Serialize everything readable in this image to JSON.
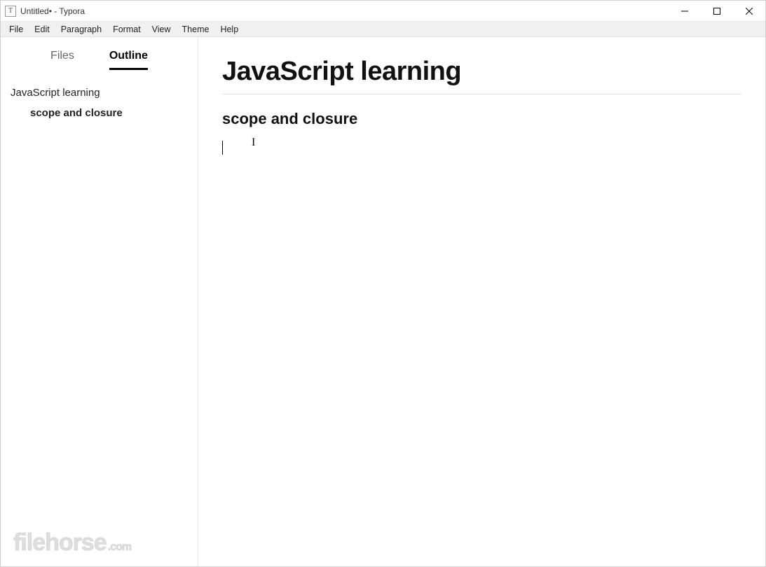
{
  "window": {
    "title": "Untitled• - Typora",
    "app_icon_letter": "T"
  },
  "menubar": {
    "items": [
      "File",
      "Edit",
      "Paragraph",
      "Format",
      "View",
      "Theme",
      "Help"
    ]
  },
  "sidebar": {
    "tabs": {
      "files": "Files",
      "outline": "Outline"
    },
    "outline": {
      "h1": "JavaScript learning",
      "h2": "scope and closure"
    }
  },
  "document": {
    "h1": "JavaScript learning",
    "h2": "scope and closure"
  },
  "watermark": {
    "brand": "filehorse",
    "tld": ".com"
  }
}
